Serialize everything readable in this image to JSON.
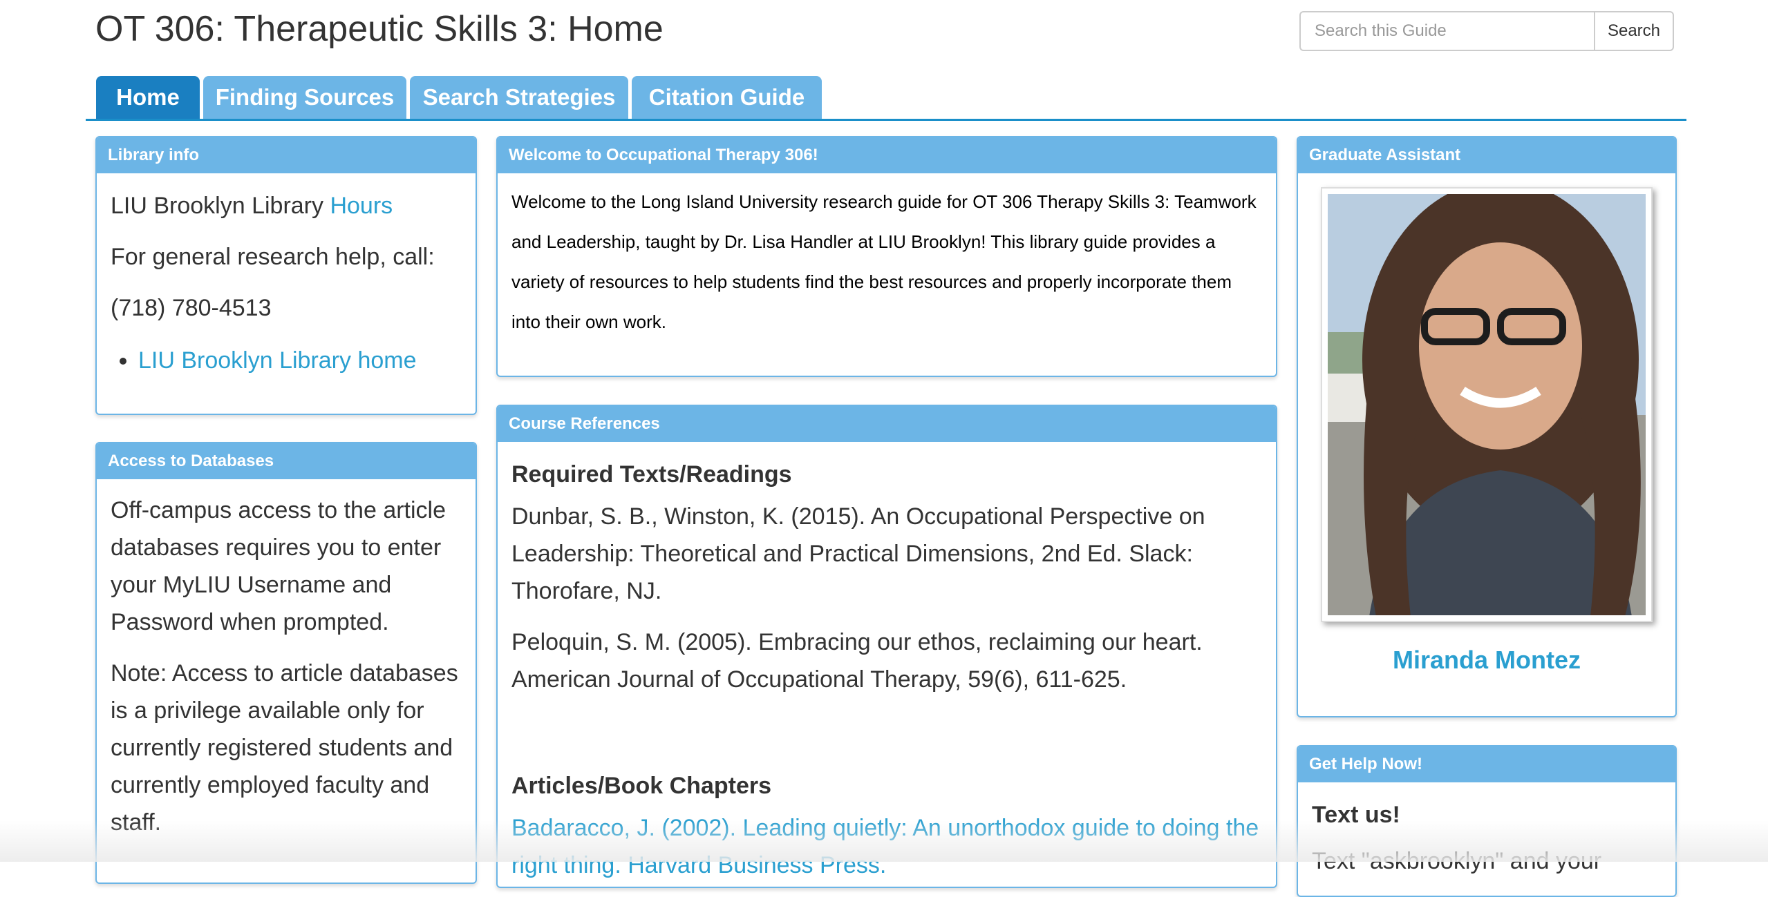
{
  "header": {
    "title": "OT 306: Therapeutic Skills 3: Home",
    "search_placeholder": "Search this Guide",
    "search_button": "Search"
  },
  "tabs": [
    {
      "label": "Home",
      "active": true
    },
    {
      "label": "Finding Sources",
      "active": false
    },
    {
      "label": "Search Strategies",
      "active": false
    },
    {
      "label": "Citation Guide",
      "active": false
    }
  ],
  "library_info": {
    "heading": "Library info",
    "line1_prefix": "LIU Brooklyn Library ",
    "hours_link": "Hours",
    "line2": "For general research help, call:",
    "phone": "(718) 780-4513",
    "home_link": "LIU Brooklyn Library home"
  },
  "databases": {
    "heading": "Access to Databases",
    "para1": "Off-campus access to the article databases requires you to enter your MyLIU Username and Password when prompted.",
    "para2": "Note: Access to article databases is a privilege available only for currently registered students and currently employed faculty and staff."
  },
  "welcome": {
    "heading": "Welcome to Occupational Therapy 306!",
    "text": "Welcome to the Long Island University research guide for OT 306 Therapy Skills 3: Teamwork and Leadership, taught by Dr. Lisa Handler at LIU Brooklyn! This library guide provides a variety of resources to help students find the best resources and properly incorporate them into their own work."
  },
  "course_refs": {
    "heading": "Course References",
    "required_heading": "Required Texts/Readings",
    "ref1": "Dunbar, S. B., Winston, K. (2015). An Occupational Perspective on Leadership: Theoretical and Practical Dimensions, 2nd Ed. Slack: Thorofare, NJ.",
    "ref2": "Peloquin, S. M. (2005). Embracing our ethos, reclaiming our heart. American Journal of Occupational Therapy, 59(6), 611-625.",
    "articles_heading": "Articles/Book Chapters",
    "article1": "Badaracco, J. (2002). Leading quietly: An unorthodox guide to doing the right thing. Harvard Business Press."
  },
  "assistant": {
    "heading": "Graduate Assistant",
    "name": "Miranda Montez"
  },
  "help": {
    "heading": "Get Help Now!",
    "title": "Text us!",
    "partial": "Text \"askbrooklyn\" and your"
  }
}
